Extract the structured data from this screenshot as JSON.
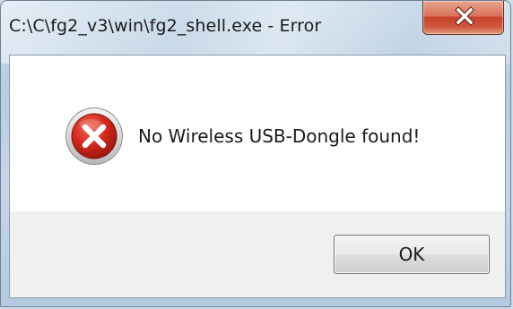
{
  "window": {
    "title": "C:\\C\\fg2_v3\\win\\fg2_shell.exe - Error"
  },
  "titlebar": {
    "close_icon": "close-icon"
  },
  "dialog": {
    "icon": "error-icon",
    "message": "No Wireless USB-Dongle found!",
    "ok_label": "OK"
  },
  "colors": {
    "close_button": "#c8412a",
    "error_icon": "#c4271c",
    "title_bar": "#b9cfe3"
  }
}
